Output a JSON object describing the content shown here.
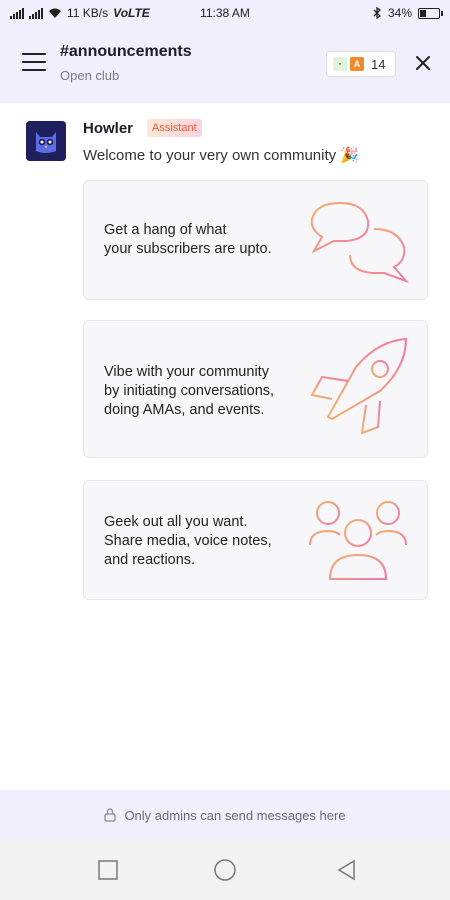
{
  "status_bar": {
    "speed": "11 KB/s",
    "network": "VoLTE",
    "time": "11:38 AM",
    "battery": "34%",
    "battery_level": 0.34
  },
  "header": {
    "channel_title": "#announcements",
    "channel_subtitle": "Open club",
    "member_avatar_a": "A",
    "member_count": "14"
  },
  "message": {
    "sender": "Howler",
    "badge": "Assistant",
    "text": "Welcome to your very own community 🎉"
  },
  "cards": [
    {
      "text": "Get a hang of what\nyour subscribers are upto.",
      "icon": "chat-bubbles-icon"
    },
    {
      "text": "Vibe with your community\nby initiating conversations,\ndoing AMAs, and events.",
      "icon": "rocket-icon"
    },
    {
      "text": "Geek out all you want.\nShare media, voice notes,\nand reactions.",
      "icon": "people-group-icon"
    }
  ],
  "footer": {
    "notice": "Only admins can send messages here"
  },
  "colors": {
    "accent_orange": "#f5a36a",
    "accent_pink": "#f07aa8",
    "header_bg": "#f1effb"
  }
}
